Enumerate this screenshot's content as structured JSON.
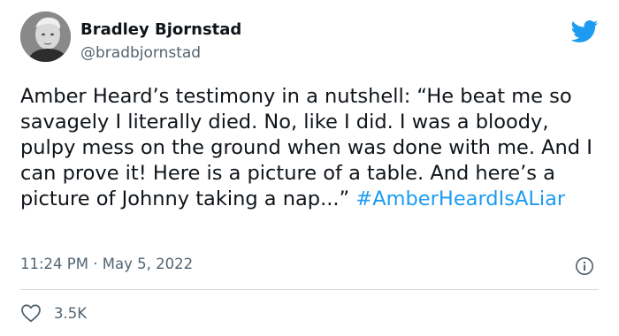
{
  "author": {
    "name": "Bradley Bjornstad",
    "handle": "@bradbjornstad"
  },
  "icons": {
    "brand": "twitter-bird-icon",
    "info": "info-icon",
    "like": "heart-icon",
    "brand_color": "#1d9bf0"
  },
  "tweet": {
    "text": "Amber Heard’s testimony in a nutshell: “He beat me so savagely I literally died. No, like I did. I was a bloody, pulpy mess on the ground when was done with me. And I can prove it! Here is a picture of a table. And here’s a picture of Johnny taking a nap...”",
    "hashtag": "#AmberHeardIsALiar",
    "time": "11:24 PM",
    "separator": " · ",
    "date": "May 5, 2022"
  },
  "engagement": {
    "likes": "3.5K"
  }
}
